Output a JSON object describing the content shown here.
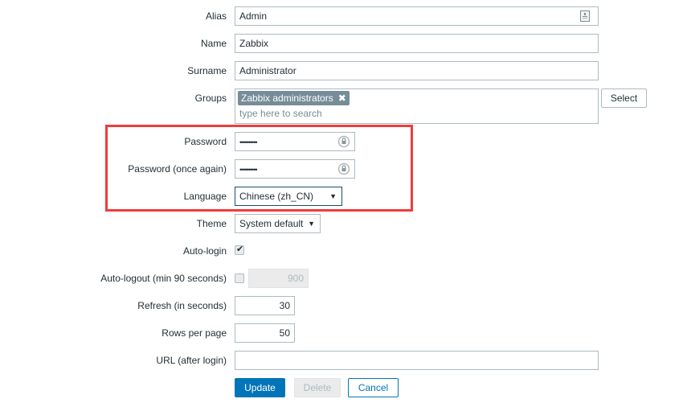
{
  "form": {
    "alias": {
      "label": "Alias",
      "value": "Admin",
      "icon": "contact-card-icon"
    },
    "name": {
      "label": "Name",
      "value": "Zabbix"
    },
    "surname": {
      "label": "Surname",
      "value": "Administrator"
    },
    "groups": {
      "label": "Groups",
      "tags": [
        "Zabbix administrators"
      ],
      "placeholder": "type here to search",
      "select_label": "Select",
      "remove_icon": "close-icon"
    },
    "password": {
      "label": "Password",
      "value": "••••••••••",
      "icon": "password-reveal-icon"
    },
    "password_again": {
      "label": "Password (once again)",
      "value": "••••••••••",
      "icon": "password-reveal-icon"
    },
    "language": {
      "label": "Language",
      "selected": "Chinese (zh_CN)",
      "arrow": "▼"
    },
    "theme": {
      "label": "Theme",
      "selected": "System default",
      "arrow": "▼"
    },
    "auto_login": {
      "label": "Auto-login",
      "checked": true,
      "check_glyph": "✔"
    },
    "auto_logout": {
      "label": "Auto-logout (min 90 seconds)",
      "checked": false,
      "value": "900"
    },
    "refresh": {
      "label": "Refresh (in seconds)",
      "value": "30"
    },
    "rows_per_page": {
      "label": "Rows per page",
      "value": "50"
    },
    "url": {
      "label": "URL (after login)",
      "value": ""
    }
  },
  "buttons": {
    "update": "Update",
    "delete": "Delete",
    "cancel": "Cancel"
  },
  "colors": {
    "primary": "#0275b8",
    "highlight": "#f03c3c",
    "tag_bg": "#768d99",
    "border": "#acbbc2"
  }
}
